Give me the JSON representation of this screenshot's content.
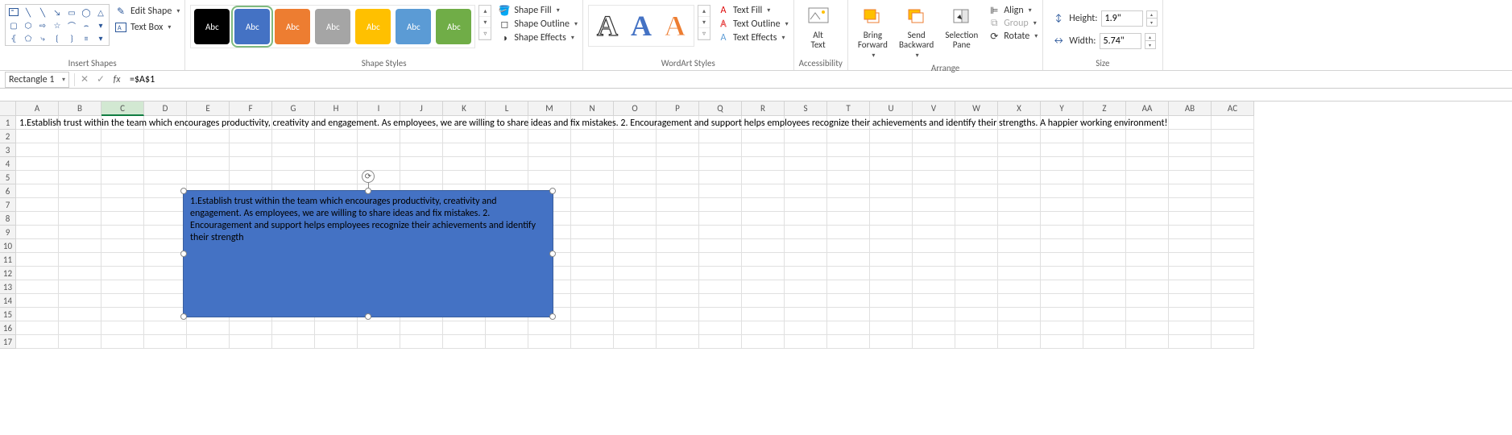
{
  "ribbon": {
    "insert_shapes": {
      "label": "Insert Shapes",
      "edit_shape": "Edit Shape",
      "text_box": "Text Box"
    },
    "shape_styles": {
      "label": "Shape Styles",
      "swatches": [
        "Abc",
        "Abc",
        "Abc",
        "Abc",
        "Abc",
        "Abc",
        "Abc"
      ],
      "shape_fill": "Shape Fill",
      "shape_outline": "Shape Outline",
      "shape_effects": "Shape Effects"
    },
    "wordart": {
      "label": "WordArt Styles",
      "text_fill": "Text Fill",
      "text_outline": "Text Outline",
      "text_effects": "Text Effects"
    },
    "accessibility": {
      "label": "Accessibility",
      "alt_text": "Alt\nText"
    },
    "arrange": {
      "label": "Arrange",
      "bring_forward": "Bring\nForward",
      "send_backward": "Send\nBackward",
      "selection_pane": "Selection\nPane",
      "align": "Align",
      "group": "Group",
      "rotate": "Rotate"
    },
    "size": {
      "label": "Size",
      "height_label": "Height:",
      "width_label": "Width:",
      "height": "1.9\"",
      "width": "5.74\""
    }
  },
  "formula_bar": {
    "name_box": "Rectangle 1",
    "value": "=$A$1"
  },
  "columns": [
    "A",
    "B",
    "C",
    "D",
    "E",
    "F",
    "G",
    "H",
    "I",
    "J",
    "K",
    "L",
    "M",
    "N",
    "O",
    "P",
    "Q",
    "R",
    "S",
    "T",
    "U",
    "V",
    "W",
    "X",
    "Y",
    "Z",
    "AA",
    "AB",
    "AC"
  ],
  "selected_col": "C",
  "rows": [
    1,
    2,
    3,
    4,
    5,
    6,
    7,
    8,
    9,
    10,
    11,
    12,
    13,
    14,
    15,
    16,
    17
  ],
  "cell_a1": "1.Establish trust within the team which encourages productivity, creativity and engagement. As employees, we are willing to share ideas and fix mistakes. 2. Encouragement and support helps employees recognize their achievements and identify their strengths. A happier working environment!",
  "shape_text": "1.Establish trust within the team which encourages productivity, creativity and engagement. As employees, we are willing to share ideas and fix mistakes. 2. Encouragement and support helps employees recognize their achievements and identify their strength"
}
